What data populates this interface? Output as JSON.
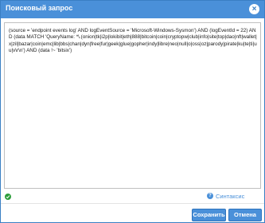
{
  "dialog": {
    "title": "Поисковый запрос",
    "close_glyph": "×",
    "close_icon": "close-icon"
  },
  "editor": {
    "query": "(source = 'endpoint events log' AND logEventSource = 'Microsoft-Windows-Sysmon') AND (logEventId = 22) AND (data MATCH 'QueryName: *\\.(onion|tk|i2p|lokibit|eth|888|bitcoin|coin|cryptopw|club|info|site|top|dao|nft|wallet|x|zil|bazar|coin|emc|lib|bbs|chan|dyn|free|fur|geek|glue|gopher|indy|libre|neo|null|o|oss|oz|parody|pirate|ku|te|ti|uu|v\\r\\n') AND (data !~ 'bitsix')",
    "valid_icon": "check-circle-icon"
  },
  "help": {
    "label": "Синтаксис",
    "glyph": "?",
    "icon": "question-circle-icon"
  },
  "buttons": {
    "save_label": "Сохранить",
    "cancel_label": "Отмена"
  },
  "colors": {
    "accent": "#4a90d9",
    "border": "#3a7fc4",
    "success": "#2e9e3c"
  }
}
